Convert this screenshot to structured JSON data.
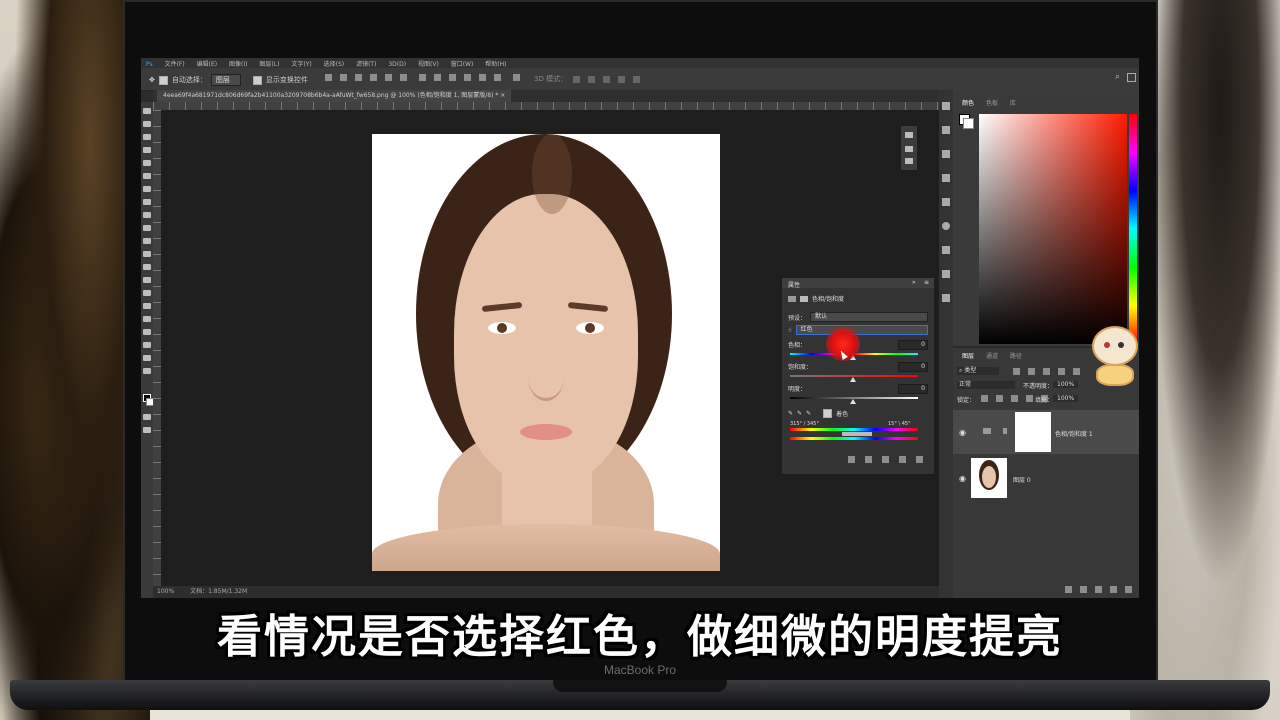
{
  "device": {
    "brand": "MacBook Pro"
  },
  "photoshop": {
    "menu": [
      "Ps",
      "文件(F)",
      "编辑(E)",
      "图像(I)",
      "图层(L)",
      "文字(Y)",
      "选择(S)",
      "滤镜(T)",
      "3D(D)",
      "视图(V)",
      "窗口(W)",
      "帮助(H)"
    ],
    "options_bar": {
      "auto_select_label": "自动选择：",
      "auto_select_value": "图层",
      "show_transform_label": "显示变换控件",
      "mode_3d_label": "3D 模式："
    },
    "document_tab": "4eea69f4a681971dc806d69fa2b41100a3209708b6b4a-aAfuWt_fw658.png @ 100% (色相/饱和度 1, 图层蒙版/8) *",
    "properties_panel": {
      "title": "属性",
      "adjustment_name": "色相/饱和度",
      "preset_label": "预设：",
      "preset_value": "默认",
      "channel_value": "红色",
      "hue_label": "色相：",
      "hue_value": "0",
      "saturation_label": "饱和度：",
      "saturation_value": "0",
      "lightness_label": "明度：",
      "lightness_value": "0",
      "colorize_label": "着色",
      "range_left": "315° / 345°",
      "range_right": "15° \\ 45°"
    },
    "color_panel": {
      "tabs": [
        "颜色",
        "色板",
        "库"
      ]
    },
    "layers_panel": {
      "tabs": [
        "图层",
        "通道",
        "路径"
      ],
      "filter_kind": "类型",
      "blend_mode": "正常",
      "opacity_label": "不透明度：",
      "opacity_value": "100%",
      "lock_label": "锁定：",
      "fill_label": "填充：",
      "fill_value": "100%",
      "layers": [
        {
          "name": "色相/饱和度 1",
          "type": "adjustment"
        },
        {
          "name": "图层 0",
          "type": "image"
        }
      ]
    },
    "status": {
      "zoom": "100%",
      "doc_info": "文档：1.85M/1.32M"
    }
  },
  "subtitle": "看情况是否选择红色，做细微的明度提亮",
  "colors": {
    "accent_red": "#e01010",
    "ps_dark": "#2b2b2b",
    "panel": "#333333"
  }
}
